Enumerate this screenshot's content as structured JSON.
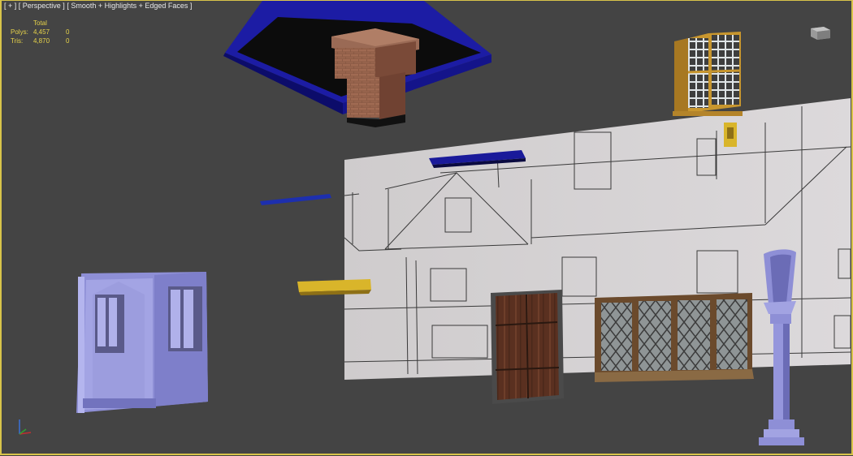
{
  "viewport": {
    "label_plus": "[ + ]",
    "label_view": "[ Perspective ]",
    "label_shading": "[ Smooth + Highlights + Edged Faces ]"
  },
  "stats": {
    "header": "Total",
    "polys_label": "Polys:",
    "polys_total": "4,457",
    "polys_sel": "0",
    "tris_label": "Tris:",
    "tris_total": "4,870",
    "tris_sel": "0"
  },
  "colors": {
    "viewport_bg": "#444444",
    "active_border": "#d8c44a",
    "stats_text": "#e6d24a",
    "wall": "#d4d1d3",
    "blue_object": "#1a1a9a",
    "yellow_object": "#d9b52a",
    "lavender_object": "#8e8fd6"
  },
  "icons": {
    "viewcube": "viewcube-icon",
    "axis_tripod": "axis-tripod-icon"
  }
}
